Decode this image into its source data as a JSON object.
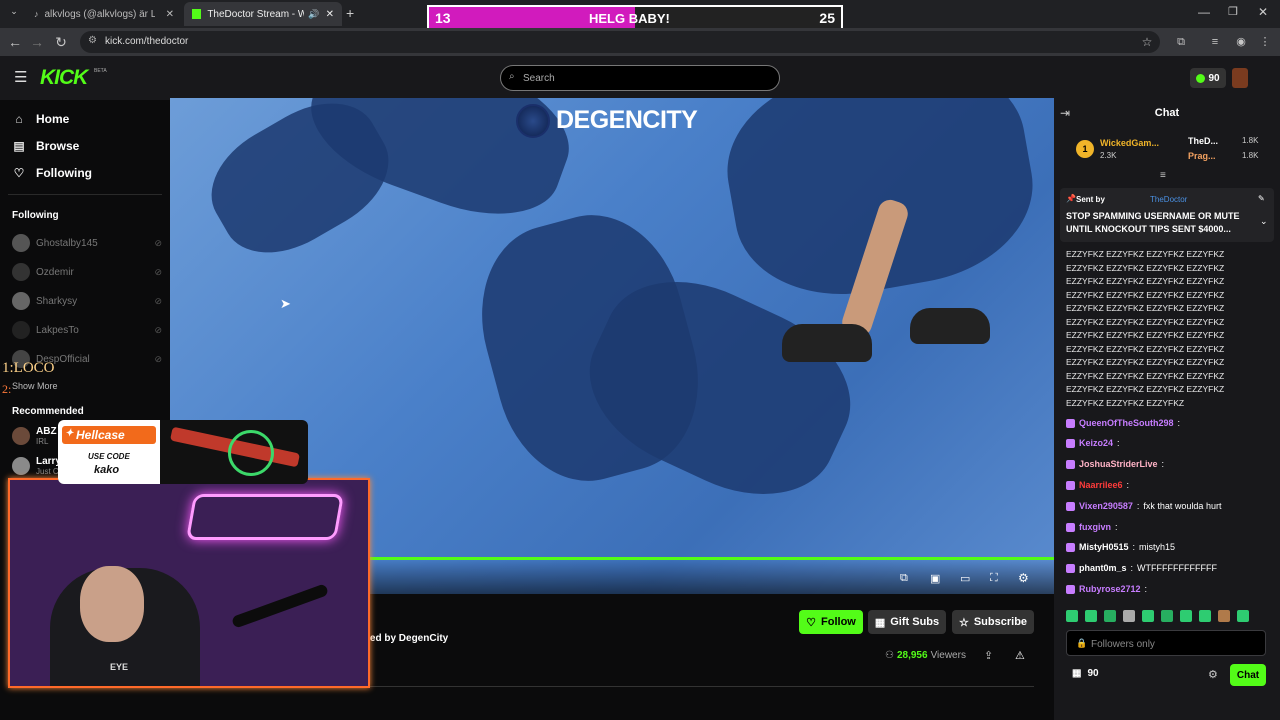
{
  "tabs": [
    {
      "title": "alkvlogs (@alkvlogs) är LIVE - T"
    },
    {
      "title": "TheDoctor Stream - Watch"
    }
  ],
  "address": {
    "url": "kick.com/thedoctor"
  },
  "banner": {
    "left": "13",
    "title": "HELG BABY!",
    "right": "25",
    "fill_fraction": 0.5
  },
  "header": {
    "logo": "KICK",
    "logo_badge": "BETA",
    "search_placeholder": "Search",
    "points": "90"
  },
  "nav": [
    {
      "label": "Home",
      "icon": "home-icon"
    },
    {
      "label": "Browse",
      "icon": "browse-icon"
    },
    {
      "label": "Following",
      "icon": "heart-icon"
    }
  ],
  "following": {
    "title": "Following",
    "items": [
      {
        "name": "Ghostalby145"
      },
      {
        "name": "Ozdemir"
      },
      {
        "name": "Sharkysy"
      },
      {
        "name": "LakpesTo"
      },
      {
        "name": "DespOfficial"
      }
    ],
    "show_more": "Show More"
  },
  "overlay_list": {
    "line1": "1:LOCO",
    "line2": "2:"
  },
  "recommended": {
    "title": "Recommended",
    "items": [
      {
        "name": "ABZ",
        "sub": "IRL"
      },
      {
        "name": "Larry",
        "sub": "Just C"
      }
    ]
  },
  "hellcase": {
    "brand": "Hellcase",
    "code_label": "USE CODE",
    "code": "kako"
  },
  "video": {
    "watermark": "DEGENCITY"
  },
  "stream": {
    "sponsor": "red by DegenCity",
    "viewers_count": "28,956",
    "viewers_label": "Viewers",
    "follow": "Follow",
    "gift": "Gift Subs",
    "subscribe": "Subscribe"
  },
  "webcam": {
    "shirt_text": "EYE"
  },
  "chat": {
    "title": "Chat",
    "leaderboard": [
      {
        "rank": "1",
        "name": "WickedGam...",
        "amount": "2.3K"
      },
      {
        "name": "TheD...",
        "amount": "1.8K"
      },
      {
        "name": "Prag...",
        "amount": "1.8K"
      }
    ],
    "pinned": {
      "sent_by": "Sent by",
      "sender": "TheDoctor",
      "text": "STOP SPAMMING USERNAME OR MUTE UNTIL KNOCKOUT TIPS SENT $4000..."
    },
    "spam_lines": [
      "EZZYFKZ EZZYFKZ EZZYFKZ EZZYFKZ",
      "EZZYFKZ EZZYFKZ EZZYFKZ EZZYFKZ",
      "EZZYFKZ EZZYFKZ EZZYFKZ EZZYFKZ",
      "EZZYFKZ EZZYFKZ EZZYFKZ EZZYFKZ",
      "EZZYFKZ EZZYFKZ EZZYFKZ EZZYFKZ",
      "EZZYFKZ EZZYFKZ EZZYFKZ EZZYFKZ",
      "EZZYFKZ EZZYFKZ EZZYFKZ EZZYFKZ",
      "EZZYFKZ EZZYFKZ EZZYFKZ EZZYFKZ",
      "EZZYFKZ EZZYFKZ EZZYFKZ EZZYFKZ",
      "EZZYFKZ EZZYFKZ EZZYFKZ EZZYFKZ",
      "EZZYFKZ EZZYFKZ EZZYFKZ EZZYFKZ",
      "EZZYFKZ EZZYFKZ EZZYFKZ"
    ],
    "messages": [
      {
        "user": "QueenOfTheSouth298",
        "color": "#c77dff",
        "text": ""
      },
      {
        "user": "Keizo24",
        "color": "#c77dff",
        "text": ""
      },
      {
        "user": "JoshuaStriderLive",
        "color": "#ffb3c6",
        "text": ""
      },
      {
        "user": "Naarrilee6",
        "color": "#ff3b3b",
        "text": ""
      },
      {
        "user": "Vixen290587",
        "color": "#c77dff",
        "text": "fxk that woulda hurt"
      },
      {
        "user": "fuxgivn",
        "color": "#c77dff",
        "text": ""
      },
      {
        "user": "MistyH0515",
        "color": "#ffffff",
        "text": "mistyh15"
      },
      {
        "user": "phant0m_s",
        "color": "#ffffff",
        "text": "WTFFFFFFFFFFFF"
      },
      {
        "user": "Rubyrose2712",
        "color": "#c77dff",
        "text": ""
      }
    ],
    "input_placeholder": "Followers only",
    "points": "90",
    "send": "Chat"
  },
  "colors": {
    "kick_green": "#53fc18",
    "banner_magenta": "#d11bbd"
  }
}
